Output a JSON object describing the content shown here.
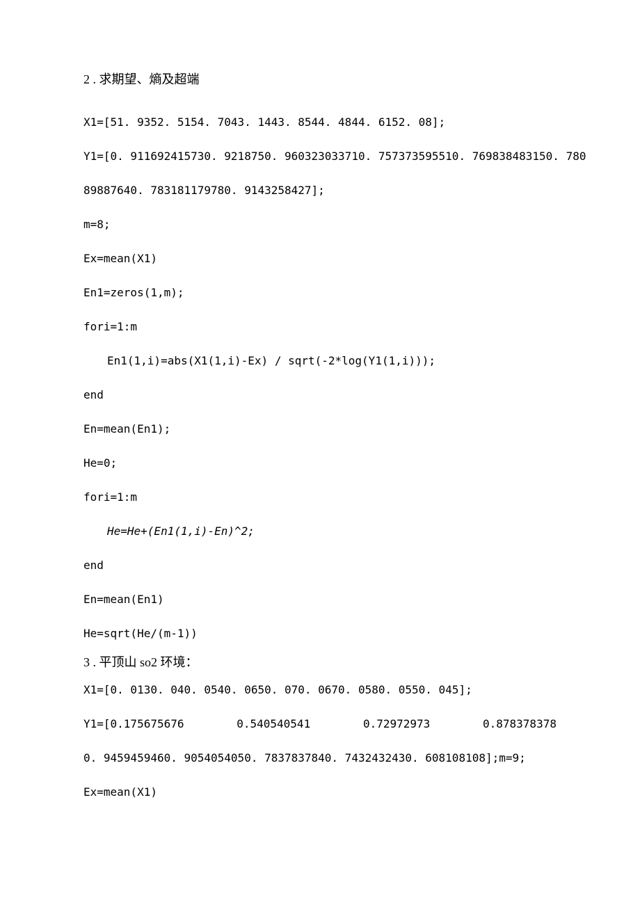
{
  "section2": {
    "heading": "2 . 求期望、熵及超端",
    "lines": [
      "X1=[51. 9352. 5154. 7043. 1443. 8544. 4844. 6152. 08];",
      "Y1=[0. 911692415730. 9218750. 960323033710. 757373595510. 769838483150. 780",
      "89887640. 783181179780. 9143258427];",
      "m=8;",
      "Ex=mean(X1)",
      "En1=zeros(1,m);",
      "fori=1:m",
      "En1(1,i)=abs(X1(1,i)-Ex) / sqrt(-2*log(Y1(1,i)));",
      "end",
      "En=mean(En1);",
      "He=0;",
      "fori=1:m",
      "He=He+(En1(1,i)-En)^2;",
      "end",
      "En=mean(En1)",
      "He=sqrt(He/(m-1))"
    ]
  },
  "section3": {
    "heading": "3 . 平顶山 so2 环境：",
    "lines": [
      "X1=[0. 0130. 040. 0540. 0650. 070. 0670. 0580. 0550. 045];"
    ],
    "justify_line": {
      "p1": "Y1=[0.175675676",
      "p2": "0.540540541",
      "p3": "0.72972973",
      "p4": "0.878378378"
    },
    "tail": [
      "0. 9459459460. 9054054050. 7837837840. 7432432430. 608108108];m=9;",
      "Ex=mean(X1)"
    ]
  }
}
